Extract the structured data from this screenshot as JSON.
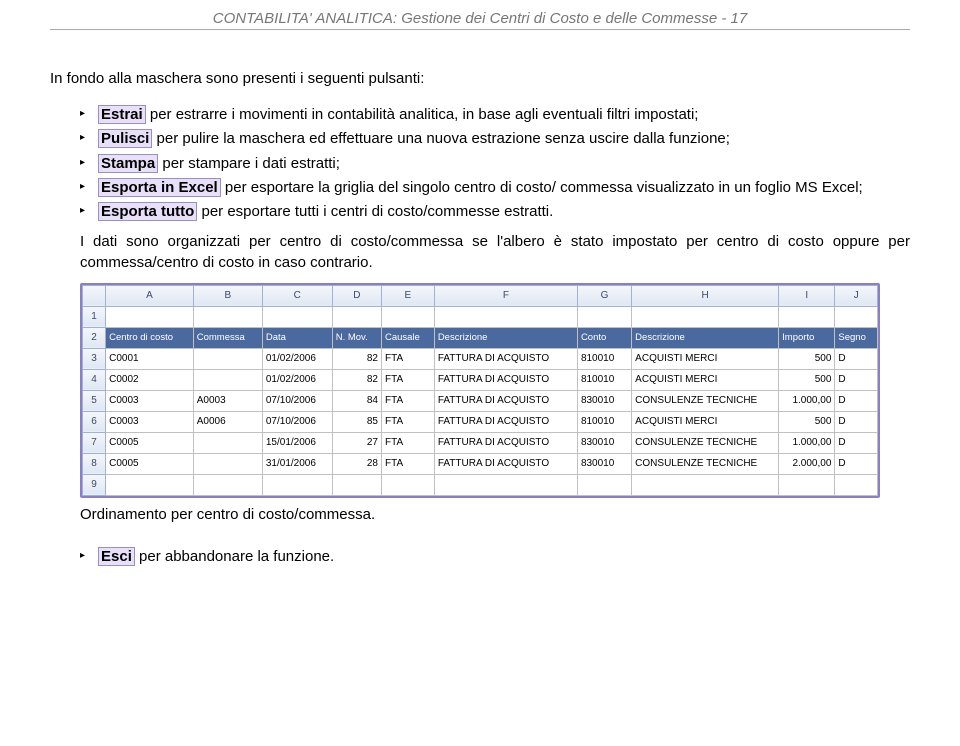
{
  "header": {
    "title": "CONTABILITA' ANALITICA: Gestione dei Centri di Costo e delle Commesse - 17"
  },
  "intro": "In fondo alla maschera sono presenti i seguenti pulsanti:",
  "bullets": {
    "b1": {
      "kw": "Estrai",
      "text": " per estrarre i movimenti in contabilità analitica, in base agli eventuali filtri impostati;"
    },
    "b2": {
      "kw": "Pulisci",
      "text": " per pulire la maschera ed effettuare una nuova estrazione senza uscire dalla funzione;"
    },
    "b3": {
      "kw": "Stampa",
      "text": " per stampare i dati estratti;"
    },
    "b4": {
      "kw": "Esporta in Excel",
      "text": " per esportare la griglia del singolo centro di costo/ commessa visualizzato in un foglio MS Excel;"
    },
    "b5": {
      "kw": "Esporta tutto",
      "text": " per esportare tutti i centri di costo/commesse estratti."
    }
  },
  "para1": "I dati sono organizzati per centro di costo/commessa se l'albero è stato impostato per centro di costo oppure per commessa/centro di costo in caso contrario.",
  "excel": {
    "cols": [
      "A",
      "B",
      "C",
      "D",
      "E",
      "F",
      "G",
      "H",
      "I",
      "J"
    ],
    "rows": [
      "1",
      "2",
      "3",
      "4",
      "5",
      "6",
      "7",
      "8",
      "9"
    ],
    "headerRow": {
      "A": "Centro di costo",
      "B": "Commessa",
      "C": "Data",
      "D": "N. Mov.",
      "E": "Causale",
      "F": "Descrizione",
      "G": "Conto",
      "H": "Descrizione",
      "I": "Importo",
      "J": "Segno"
    },
    "dataRows": [
      {
        "A": "C0001",
        "B": "",
        "C": "01/02/2006",
        "D": "82",
        "E": "FTA",
        "F": "FATTURA DI ACQUISTO",
        "G": "810010",
        "H": "ACQUISTI MERCI",
        "I": "500",
        "J": "D"
      },
      {
        "A": "C0002",
        "B": "",
        "C": "01/02/2006",
        "D": "82",
        "E": "FTA",
        "F": "FATTURA DI ACQUISTO",
        "G": "810010",
        "H": "ACQUISTI MERCI",
        "I": "500",
        "J": "D"
      },
      {
        "A": "C0003",
        "B": "A0003",
        "C": "07/10/2006",
        "D": "84",
        "E": "FTA",
        "F": "FATTURA DI ACQUISTO",
        "G": "830010",
        "H": "CONSULENZE TECNICHE",
        "I": "1.000,00",
        "J": "D"
      },
      {
        "A": "C0003",
        "B": "A0006",
        "C": "07/10/2006",
        "D": "85",
        "E": "FTA",
        "F": "FATTURA DI ACQUISTO",
        "G": "810010",
        "H": "ACQUISTI MERCI",
        "I": "500",
        "J": "D"
      },
      {
        "A": "C0005",
        "B": "",
        "C": "15/01/2006",
        "D": "27",
        "E": "FTA",
        "F": "FATTURA DI ACQUISTO",
        "G": "830010",
        "H": "CONSULENZE TECNICHE",
        "I": "1.000,00",
        "J": "D"
      },
      {
        "A": "C0005",
        "B": "",
        "C": "31/01/2006",
        "D": "28",
        "E": "FTA",
        "F": "FATTURA DI ACQUISTO",
        "G": "830010",
        "H": "CONSULENZE TECNICHE",
        "I": "2.000,00",
        "J": "D"
      }
    ]
  },
  "caption": "Ordinamento per centro di costo/commessa.",
  "final": {
    "kw": "Esci",
    "text": " per abbandonare la funzione."
  }
}
